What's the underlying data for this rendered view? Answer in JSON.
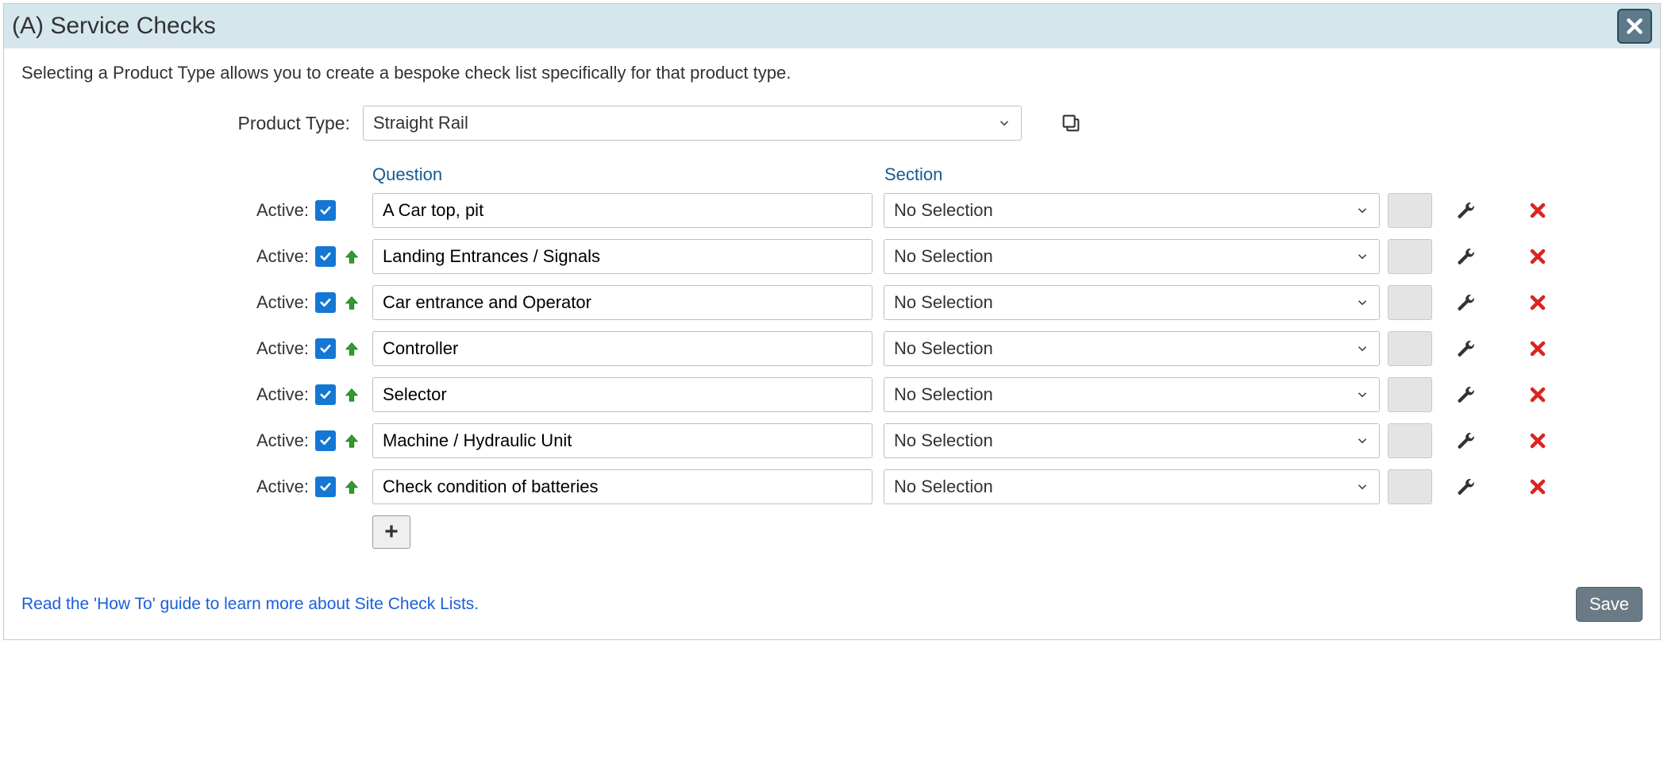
{
  "header": {
    "title": "(A) Service Checks"
  },
  "intro": "Selecting a Product Type allows you to create a bespoke check list specifically for that product type.",
  "product_type": {
    "label": "Product Type:",
    "value": "Straight Rail"
  },
  "columns": {
    "question": "Question",
    "section": "Section"
  },
  "active_label": "Active:",
  "rows": [
    {
      "active": true,
      "has_up": false,
      "question": "A Car top, pit",
      "section": "No Selection"
    },
    {
      "active": true,
      "has_up": true,
      "question": "Landing Entrances / Signals",
      "section": "No Selection"
    },
    {
      "active": true,
      "has_up": true,
      "question": "Car entrance and Operator",
      "section": "No Selection"
    },
    {
      "active": true,
      "has_up": true,
      "question": "Controller",
      "section": "No Selection"
    },
    {
      "active": true,
      "has_up": true,
      "question": "Selector",
      "section": "No Selection"
    },
    {
      "active": true,
      "has_up": true,
      "question": "Machine / Hydraulic Unit",
      "section": "No Selection"
    },
    {
      "active": true,
      "has_up": true,
      "question": "Check condition of batteries",
      "section": "No Selection"
    }
  ],
  "footer": {
    "howto": "Read the 'How To' guide to learn more about Site Check Lists.",
    "save": "Save"
  },
  "icons": {
    "add": "+"
  }
}
